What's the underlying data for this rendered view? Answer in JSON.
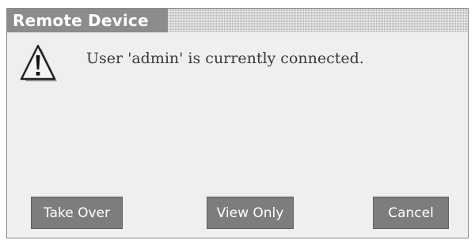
{
  "dialog": {
    "title": "Remote Device",
    "message": "User 'admin' is currently connected.",
    "icon": "warning-icon",
    "buttons": {
      "take_over": "Take Over",
      "view_only": "View Only",
      "cancel": "Cancel"
    }
  }
}
